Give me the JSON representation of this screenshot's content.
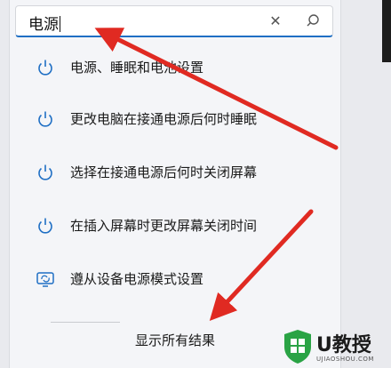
{
  "search": {
    "query": "电源"
  },
  "results": [
    {
      "label": "电源、睡眠和电池设置",
      "icon": "power-icon"
    },
    {
      "label": "更改电脑在接通电源后何时睡眠",
      "icon": "power-icon"
    },
    {
      "label": "选择在接通电源后何时关闭屏幕",
      "icon": "power-icon"
    },
    {
      "label": "在插入屏幕时更改屏幕关闭时间",
      "icon": "power-icon"
    },
    {
      "label": "遵从设备电源模式设置",
      "icon": "device-sync-icon"
    }
  ],
  "footer": {
    "show_all": "显示所有结果"
  },
  "watermark": {
    "brand": "U教授",
    "url": "UJIAOSHOU.COM"
  },
  "colors": {
    "accent": "#1f6fc4",
    "arrow": "#e02a22",
    "watermark_green": "#2aa345"
  }
}
